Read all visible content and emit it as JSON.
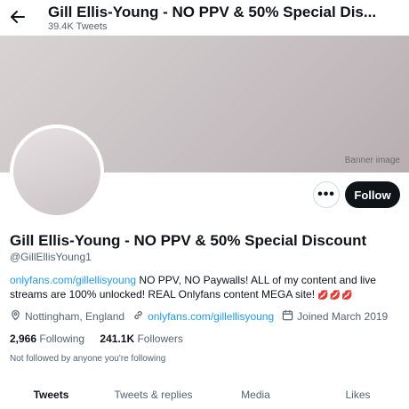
{
  "header": {
    "title": "Gill Ellis-Young - NO PPV & 50% Special Dis...",
    "tweet_count": "39.4K Tweets"
  },
  "banner": {
    "placeholder": "Banner image"
  },
  "actions": {
    "more_label": "•••",
    "follow_label": "Follow"
  },
  "profile": {
    "name": "Gill Ellis-Young - NO PPV & 50% Special Discount",
    "handle": "@GillEllisYoung1",
    "bio_link": "onlyfans.com/gillellisyoung",
    "bio_text": " NO PPV, NO Paywalls! ALL of my content and live streams are 100% unlocked! REAL Onlyfans content MEGA site!",
    "bio_emoji": "💋💋💋",
    "location": "Nottingham, England",
    "website": "onlyfans.com/gillellisyoung",
    "joined": "Joined March 2019"
  },
  "stats": {
    "following_count": "2,966",
    "following_label": "Following",
    "followers_count": "241.1K",
    "followers_label": "Followers"
  },
  "not_followed": "Not followed by anyone you're following",
  "tabs": [
    {
      "label": "Tweets"
    },
    {
      "label": "Tweets & replies"
    },
    {
      "label": "Media"
    },
    {
      "label": "Likes"
    }
  ],
  "colors": {
    "accent": "#1d9bf0",
    "text": "#0f1419",
    "muted": "#536471",
    "follow_bg": "#0f1419"
  }
}
